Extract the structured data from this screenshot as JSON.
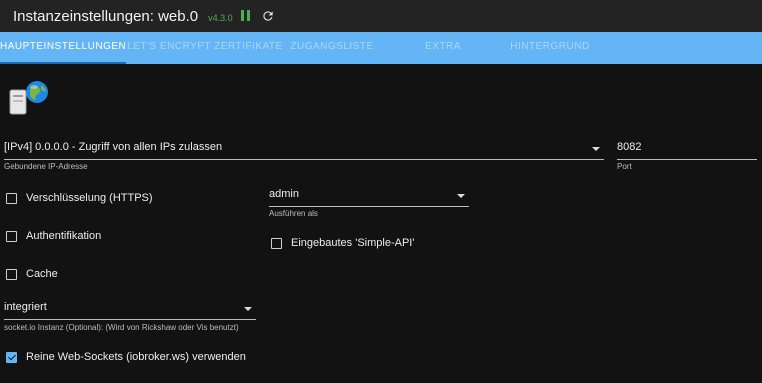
{
  "window": {
    "title": "Instanzeinstellungen: web.0",
    "version": "v4.3.0",
    "icons": [
      "pause-icon",
      "reload-icon"
    ]
  },
  "colors": {
    "accent": "#64b5f6",
    "status_green": "#4caf50",
    "background": "#121212",
    "titlebar": "#232323"
  },
  "tabs": [
    {
      "label": "HAUPTEINSTELLUNGEN",
      "active": true
    },
    {
      "label": "LET'S ENCRYPT ZERTIFIKATE",
      "active": false
    },
    {
      "label": "ZUGANGSLISTE",
      "active": false
    },
    {
      "label": "EXTRA",
      "active": false
    },
    {
      "label": "HINTERGRUND",
      "active": false
    }
  ],
  "form": {
    "ip": {
      "value": "[IPv4] 0.0.0.0 - Zugriff von allen IPs zulassen",
      "helper": "Gebundene IP-Adresse"
    },
    "port": {
      "value": "8082",
      "helper": "Port"
    },
    "https": {
      "label": "Verschlüsselung (HTTPS)",
      "checked": false
    },
    "run_as": {
      "value": "admin",
      "helper": "Ausführen als"
    },
    "auth": {
      "label": "Authentifikation",
      "checked": false
    },
    "simple_api": {
      "label": "Eingebautes 'Simple-API'",
      "checked": false
    },
    "cache": {
      "label": "Cache",
      "checked": false
    },
    "socketio": {
      "value": "integriert",
      "helper": "socket.io Instanz (Optional): (Wird von Rickshaw oder Vis benutzt)"
    },
    "websockets": {
      "label": "Reine Web-Sockets (iobroker.ws) verwenden",
      "checked": true
    }
  }
}
